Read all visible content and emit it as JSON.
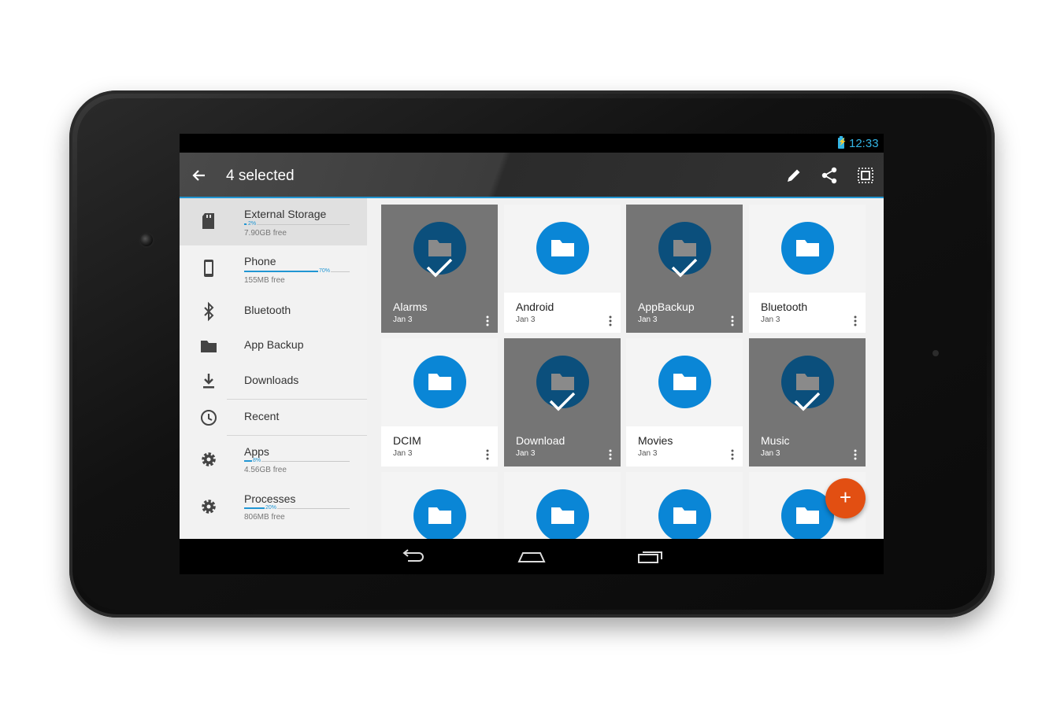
{
  "status_bar": {
    "time": "12:33"
  },
  "action_bar": {
    "title": "4 selected",
    "actions": [
      "edit-icon",
      "share-icon",
      "select-all-icon"
    ]
  },
  "sidebar": {
    "items": [
      {
        "label": "External Storage",
        "percent_used": 2,
        "percent_label": "2%",
        "free": "7.90GB free",
        "icon": "sd-card-icon",
        "active": true
      },
      {
        "label": "Phone",
        "percent_used": 70,
        "percent_label": "70%",
        "free": "155MB free",
        "icon": "phone-icon"
      },
      {
        "label": "Bluetooth",
        "icon": "bluetooth-icon"
      },
      {
        "label": "App Backup",
        "icon": "folder-icon"
      },
      {
        "label": "Downloads",
        "icon": "download-icon"
      },
      {
        "label": "Recent",
        "icon": "clock-icon"
      },
      {
        "label": "Apps",
        "percent_used": 8,
        "percent_label": "8%",
        "free": "4.56GB free",
        "icon": "gear-icon"
      },
      {
        "label": "Processes",
        "percent_used": 20,
        "percent_label": "20%",
        "free": "806MB free",
        "icon": "gear-icon"
      }
    ]
  },
  "folders": [
    {
      "name": "Alarms",
      "date": "Jan 3",
      "selected": true
    },
    {
      "name": "Android",
      "date": "Jan 3",
      "selected": false
    },
    {
      "name": "AppBackup",
      "date": "Jan 3",
      "selected": true
    },
    {
      "name": "Bluetooth",
      "date": "Jan 3",
      "selected": false
    },
    {
      "name": "DCIM",
      "date": "Jan 3",
      "selected": false
    },
    {
      "name": "Download",
      "date": "Jan 3",
      "selected": true
    },
    {
      "name": "Movies",
      "date": "Jan 3",
      "selected": false
    },
    {
      "name": "Music",
      "date": "Jan 3",
      "selected": true
    },
    {
      "name": "",
      "date": "",
      "selected": false
    },
    {
      "name": "",
      "date": "",
      "selected": false
    },
    {
      "name": "",
      "date": "",
      "selected": false
    },
    {
      "name": "",
      "date": "",
      "selected": false
    }
  ],
  "fab": {
    "label": "+"
  },
  "colors": {
    "accent": "#2196d3",
    "folder": "#0a86d6",
    "fab": "#e24f12",
    "selected_overlay": "#757575"
  }
}
